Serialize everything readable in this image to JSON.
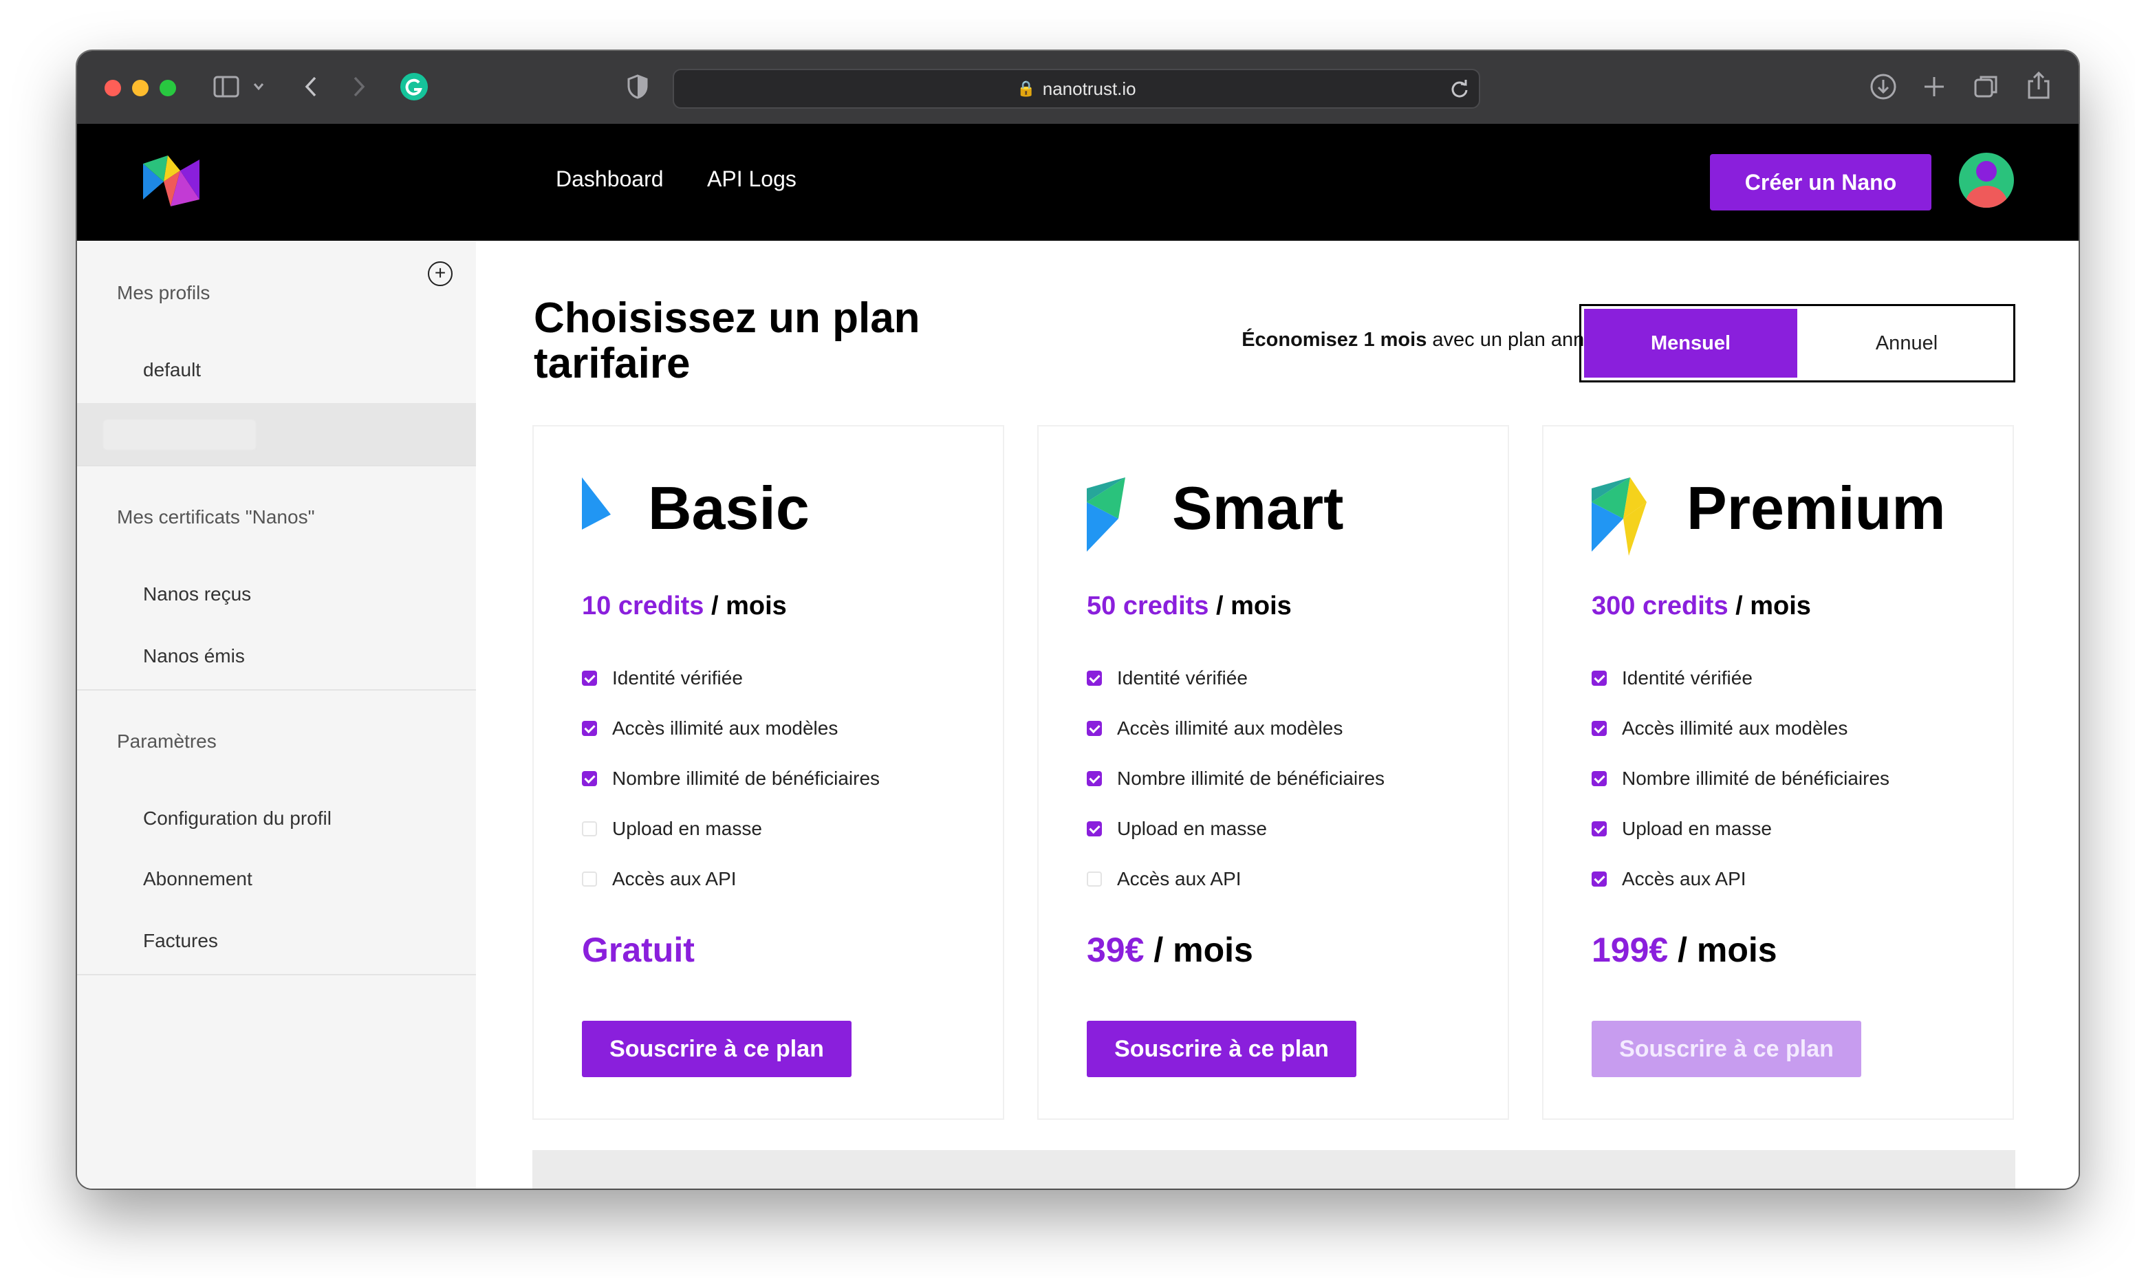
{
  "browser": {
    "url": "nanotrust.io"
  },
  "header": {
    "nav": [
      "Dashboard",
      "API Logs"
    ],
    "create_button": "Créer un Nano"
  },
  "sidebar": {
    "profiles_title": "Mes profils",
    "profiles": [
      "default"
    ],
    "certificates_title": "Mes certificats \"Nanos\"",
    "certificates_items": [
      "Nanos reçus",
      "Nanos émis"
    ],
    "settings_title": "Paramètres",
    "settings_items": [
      "Configuration du profil",
      "Abonnement",
      "Factures"
    ]
  },
  "main": {
    "title": "Choisissez un plan tarifaire",
    "savings_bold": "Économisez 1 mois",
    "savings_rest": " avec un plan annuel",
    "billing_toggle": {
      "monthly": "Mensuel",
      "yearly": "Annuel",
      "selected": "Mensuel"
    },
    "feature_labels": [
      "Identité vérifiée",
      "Accès illimité aux modèles",
      "Nombre illimité de bénéficiaires",
      "Upload en masse",
      "Accès aux API"
    ],
    "plans": [
      {
        "name": "Basic",
        "credits": "10 credits",
        "per": " / mois",
        "features_enabled": [
          true,
          true,
          true,
          false,
          false
        ],
        "price_highlight": "Gratuit",
        "price_suffix": "",
        "button": "Souscrire à ce plan",
        "button_enabled": true
      },
      {
        "name": "Smart",
        "credits": "50 credits",
        "per": " / mois",
        "features_enabled": [
          true,
          true,
          true,
          true,
          false
        ],
        "price_highlight": "39€",
        "price_suffix": " / mois",
        "button": "Souscrire à ce plan",
        "button_enabled": true
      },
      {
        "name": "Premium",
        "credits": "300 credits",
        "per": " / mois",
        "features_enabled": [
          true,
          true,
          true,
          true,
          true
        ],
        "price_highlight": "199€",
        "price_suffix": " / mois",
        "button": "Souscrire à ce plan",
        "button_enabled": false
      }
    ]
  },
  "colors": {
    "accent": "#8a1fdc",
    "accent_disabled": "#c79cef",
    "header_bg": "#000000",
    "sidebar_bg": "#f5f5f5"
  }
}
